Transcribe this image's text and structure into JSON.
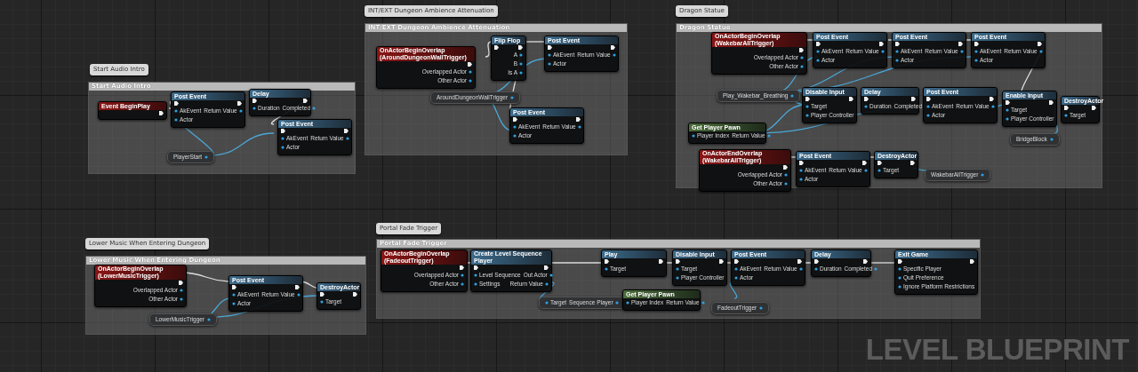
{
  "graph": {
    "comments": [
      {
        "bubble": "Start Audio Intro",
        "title": "Start Audio Intro",
        "nodes": [
          {
            "kind": "event",
            "title": "Event BeginPlay"
          },
          {
            "kind": "function",
            "title": "Post Event",
            "inputs": [
              "AkEvent",
              "Actor"
            ],
            "outputs": [
              "Return Value"
            ]
          },
          {
            "kind": "latent",
            "title": "Delay",
            "inputs": [
              "Duration"
            ],
            "outputs": [
              "Completed"
            ]
          },
          {
            "kind": "function",
            "title": "Post Event",
            "inputs": [
              "AkEvent",
              "Actor"
            ],
            "outputs": [
              "Return Value"
            ]
          },
          {
            "kind": "variable",
            "title": "PlayerStart"
          }
        ]
      },
      {
        "bubble": "INT/EXT Dungeon Ambience Attenuation",
        "title": "INT/EXT Dungeon Ambience Attenuation",
        "nodes": [
          {
            "kind": "event",
            "title": "OnActorBeginOverlap (AroundDungeonWallTrigger)",
            "outputs": [
              "Overlapped Actor",
              "Other Actor"
            ]
          },
          {
            "kind": "function",
            "title": "Flip Flop",
            "outputs": [
              "A",
              "B",
              "Is A"
            ]
          },
          {
            "kind": "function",
            "title": "Post Event",
            "inputs": [
              "AkEvent",
              "Actor"
            ],
            "outputs": [
              "Return Value"
            ]
          },
          {
            "kind": "variable",
            "title": "AroundDungeonWallTrigger"
          },
          {
            "kind": "function",
            "title": "Post Event",
            "inputs": [
              "AkEvent",
              "Actor"
            ],
            "outputs": [
              "Return Value"
            ]
          }
        ]
      },
      {
        "bubble": "Dragon Statue",
        "title": "Dragon Statue",
        "nodes": [
          {
            "kind": "event",
            "title": "OnActorBeginOverlap (WakebarAllTrigger)",
            "outputs": [
              "Overlapped Actor",
              "Other Actor"
            ]
          },
          {
            "kind": "function",
            "title": "Post Event",
            "inputs": [
              "AkEvent",
              "Actor"
            ],
            "outputs": [
              "Return Value"
            ]
          },
          {
            "kind": "function",
            "title": "Post Event",
            "inputs": [
              "AkEvent",
              "Actor"
            ],
            "outputs": [
              "Return Value"
            ]
          },
          {
            "kind": "function",
            "title": "Post Event",
            "inputs": [
              "AkEvent",
              "Actor"
            ],
            "outputs": [
              "Return Value"
            ]
          },
          {
            "kind": "variable",
            "title": "Play_Wakebar_Breathing"
          },
          {
            "kind": "function",
            "title": "Disable Input",
            "inputs": [
              "Target",
              "Player Controller"
            ]
          },
          {
            "kind": "latent",
            "title": "Delay",
            "inputs": [
              "Duration"
            ],
            "outputs": [
              "Completed"
            ]
          },
          {
            "kind": "function",
            "title": "Post Event",
            "inputs": [
              "AkEvent",
              "Actor"
            ],
            "outputs": [
              "Return Value"
            ]
          },
          {
            "kind": "function",
            "title": "Enable Input",
            "inputs": [
              "Target",
              "Player Controller"
            ]
          },
          {
            "kind": "function",
            "title": "DestroyActor",
            "inputs": [
              "Target"
            ]
          },
          {
            "kind": "variable",
            "title": "BridgeBlock"
          },
          {
            "kind": "pure",
            "title": "Get Player Pawn",
            "inputs": [
              "Player Index"
            ],
            "outputs": [
              "Return Value"
            ]
          },
          {
            "kind": "event",
            "title": "OnActorEndOverlap (WakebarAllTrigger)",
            "outputs": [
              "Overlapped Actor",
              "Other Actor"
            ]
          },
          {
            "kind": "function",
            "title": "Post Event",
            "inputs": [
              "AkEvent",
              "Actor"
            ],
            "outputs": [
              "Return Value"
            ]
          },
          {
            "kind": "function",
            "title": "DestroyActor",
            "inputs": [
              "Target"
            ]
          },
          {
            "kind": "variable",
            "title": "WakebarAllTrigger"
          }
        ]
      },
      {
        "bubble": "Lower Music When Entering Dungeon",
        "title": "Lower Music When Entering Dungeon",
        "nodes": [
          {
            "kind": "event",
            "title": "OnActorBeginOverlap (LowerMusicTrigger)",
            "outputs": [
              "Overlapped Actor",
              "Other Actor"
            ]
          },
          {
            "kind": "function",
            "title": "Post Event",
            "inputs": [
              "AkEvent",
              "Actor"
            ],
            "outputs": [
              "Return Value"
            ]
          },
          {
            "kind": "function",
            "title": "DestroyActor",
            "inputs": [
              "Target"
            ]
          },
          {
            "kind": "variable",
            "title": "LowerMusicTrigger"
          }
        ]
      },
      {
        "bubble": "Portal Fade Trigger",
        "title": "Portal Fade Trigger",
        "nodes": [
          {
            "kind": "event",
            "title": "OnActorBeginOverlap (FadeoutTrigger)",
            "outputs": [
              "Overlapped Actor",
              "Other Actor"
            ]
          },
          {
            "kind": "function",
            "title": "Create Level Sequence Player",
            "inputs": [
              "Level Sequence",
              "Settings"
            ],
            "outputs": [
              "Out Actor",
              "Return Value"
            ]
          },
          {
            "kind": "getter",
            "title": "Sequence Player",
            "inputs": [
              "Target"
            ]
          },
          {
            "kind": "function",
            "title": "Play",
            "inputs": [
              "Target"
            ]
          },
          {
            "kind": "pure",
            "title": "Get Player Pawn",
            "inputs": [
              "Player Index"
            ],
            "outputs": [
              "Return Value"
            ]
          },
          {
            "kind": "function",
            "title": "Disable Input",
            "inputs": [
              "Target",
              "Player Controller"
            ]
          },
          {
            "kind": "function",
            "title": "Post Event",
            "inputs": [
              "AkEvent",
              "Actor"
            ],
            "outputs": [
              "Return Value"
            ]
          },
          {
            "kind": "variable",
            "title": "FadeoutTrigger"
          },
          {
            "kind": "latent",
            "title": "Delay",
            "inputs": [
              "Duration"
            ],
            "outputs": [
              "Completed"
            ]
          },
          {
            "kind": "function",
            "title": "Exit Game",
            "inputs": [
              "Specific Player",
              "Quit Preference",
              "Ignore Platform Restrictions"
            ]
          }
        ]
      }
    ],
    "watermark": "LEVEL BLUEPRINT"
  }
}
